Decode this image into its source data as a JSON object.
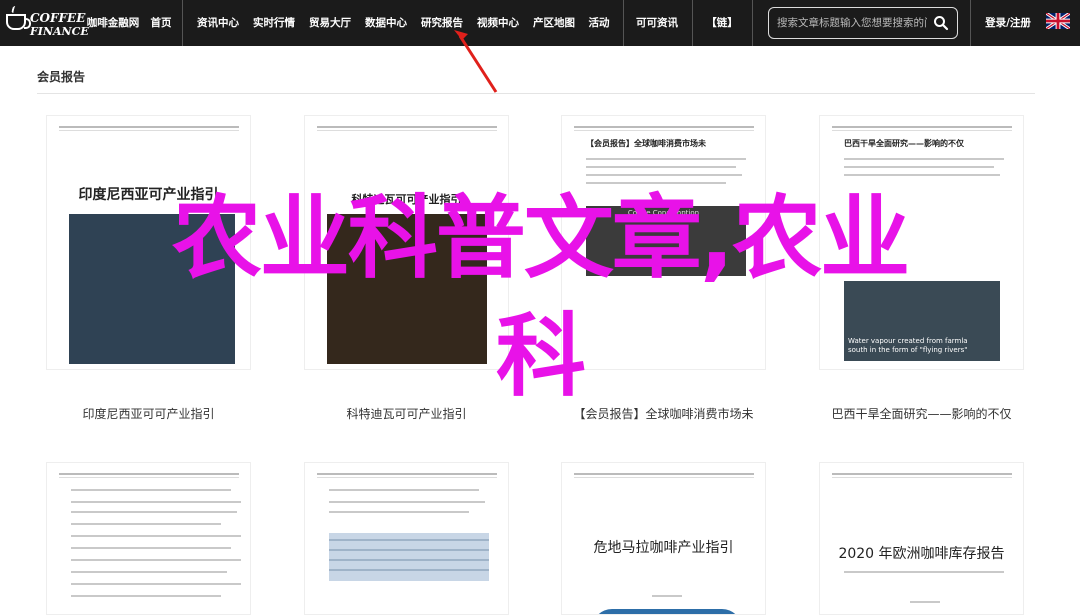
{
  "nav": {
    "logo": {
      "line1": "COFFEE",
      "line2": "FINANCE"
    },
    "items": [
      "咖啡金融网",
      "首页",
      "资讯中心",
      "实时行情",
      "贸易大厅",
      "数据中心",
      "研究报告",
      "视频中心",
      "产区地图",
      "活动",
      "可可资讯",
      "【链】"
    ],
    "search_placeholder": "搜索文章标题输入您想要搜索的问题",
    "login": "登录/注册"
  },
  "section": {
    "title": "会员报告"
  },
  "cards_row1": [
    {
      "doc_title": "印度尼西亚可产业指引",
      "caption": "印度尼西亚可可产业指引"
    },
    {
      "doc_title": "科特迪瓦可可产业指引",
      "caption": "科特迪瓦可可产业指引"
    },
    {
      "doc_title": "【会员报告】全球咖啡消费市场未",
      "caption": "【会员报告】全球咖啡消费市场未",
      "chart_label": "Coffee Consumption"
    },
    {
      "doc_title": "巴西干旱全面研究——影响的不仅",
      "caption": "巴西干旱全面研究——影响的不仅",
      "photo_text_1": "Water vapour created from farmla",
      "photo_text_2": "south in the form of \"flying rivers\""
    }
  ],
  "cards_row2": [
    {
      "doc_title": ""
    },
    {
      "doc_title": ""
    },
    {
      "doc_title": "危地马拉咖啡产业指引"
    },
    {
      "doc_title": "2020 年欧洲咖啡库存报告"
    }
  ],
  "overlay": {
    "line1": "农业科普文章,农业",
    "line2": "科"
  }
}
